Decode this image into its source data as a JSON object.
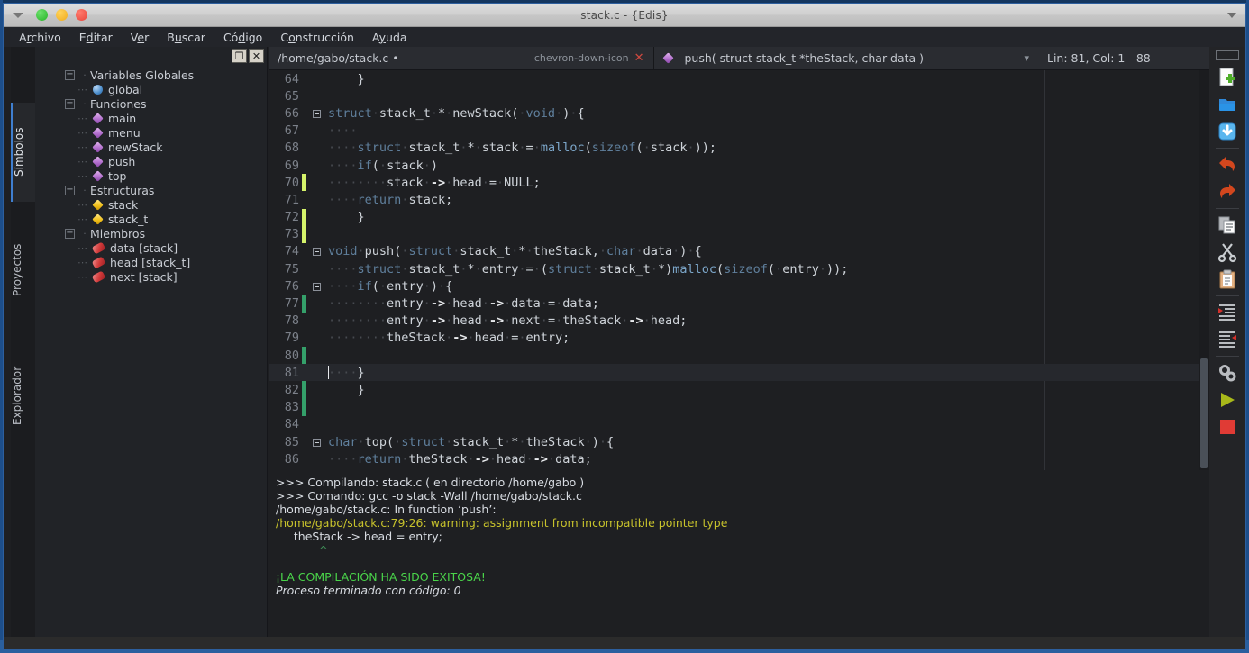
{
  "window": {
    "title": "stack.c - {Edis}",
    "controls": [
      "minimize",
      "maximize",
      "close"
    ],
    "menu_arrow_icon": "caret-down-icon"
  },
  "menubar": [
    {
      "pre": "A",
      "acc": "r",
      "post": "chivo",
      "label": "Archivo"
    },
    {
      "pre": "E",
      "acc": "d",
      "post": "itar",
      "label": "Editar"
    },
    {
      "pre": "V",
      "acc": "e",
      "post": "r",
      "label": "Ver"
    },
    {
      "pre": "B",
      "acc": "u",
      "post": "scar",
      "label": "Buscar"
    },
    {
      "pre": "Có",
      "acc": "d",
      "post": "igo",
      "label": "Código"
    },
    {
      "pre": "C",
      "acc": "o",
      "post": "nstrucción",
      "label": "Construcción"
    },
    {
      "pre": "A",
      "acc": "y",
      "post": "uda",
      "label": "Ayuda"
    }
  ],
  "vtabs": [
    {
      "label": "Símbolos",
      "active": true
    },
    {
      "label": "Proyectos",
      "active": false
    },
    {
      "label": "Explorador",
      "active": false
    }
  ],
  "panel_buttons": {
    "restore": "❐",
    "close": "✕"
  },
  "symbols_tree": [
    {
      "level": 0,
      "type": "group",
      "icon": "expander-minus",
      "label": "Variables Globales"
    },
    {
      "level": 1,
      "type": "leaf",
      "icon": "sphere-icon",
      "label": "global"
    },
    {
      "level": 0,
      "type": "group",
      "icon": "expander-minus",
      "label": "Funciones"
    },
    {
      "level": 1,
      "type": "leaf",
      "icon": "diamond-purple-icon",
      "label": "main"
    },
    {
      "level": 1,
      "type": "leaf",
      "icon": "diamond-purple-icon",
      "label": "menu"
    },
    {
      "level": 1,
      "type": "leaf",
      "icon": "diamond-purple-icon",
      "label": "newStack"
    },
    {
      "level": 1,
      "type": "leaf",
      "icon": "diamond-purple-icon",
      "label": "push"
    },
    {
      "level": 1,
      "type": "leaf",
      "icon": "diamond-purple-icon",
      "label": "top"
    },
    {
      "level": 0,
      "type": "group",
      "icon": "expander-minus",
      "label": "Estructuras"
    },
    {
      "level": 1,
      "type": "leaf",
      "icon": "diamond-gold-icon",
      "label": "stack"
    },
    {
      "level": 1,
      "type": "leaf",
      "icon": "diamond-gold-icon",
      "label": "stack_t"
    },
    {
      "level": 0,
      "type": "group",
      "icon": "expander-minus",
      "label": "Miembros"
    },
    {
      "level": 1,
      "type": "leaf",
      "icon": "capsule-red-icon",
      "label": "data [stack]"
    },
    {
      "level": 1,
      "type": "leaf",
      "icon": "capsule-red-icon",
      "label": "head [stack_t]"
    },
    {
      "level": 1,
      "type": "leaf",
      "icon": "capsule-red-icon",
      "label": "next [stack]"
    }
  ],
  "editor_tabbar": {
    "file_path": "/home/gabo/stack.c",
    "modified_dot": "•",
    "dropdown_icon": "chevron-down-icon",
    "close_icon": "close-icon",
    "symbol_icon": "diamond-purple-icon",
    "symbol": "push( struct stack_t *theStack, char data )",
    "symbol_dropdown_icon": "chevron-down-icon",
    "position": "Lin: 81, Col: 1 - 88"
  },
  "code_lines": [
    {
      "n": "64",
      "mark": "",
      "fold": "",
      "segs": [
        {
          "t": "    ",
          "c": "ws"
        },
        {
          "t": "}",
          "c": "pl"
        }
      ]
    },
    {
      "n": "65",
      "mark": "",
      "fold": "",
      "segs": []
    },
    {
      "n": "66",
      "mark": "",
      "fold": "minus",
      "segs": [
        {
          "t": "struct",
          "c": "kw"
        },
        {
          "t": "·",
          "c": "ws"
        },
        {
          "t": "stack_t",
          "c": "pl"
        },
        {
          "t": "·",
          "c": "ws"
        },
        {
          "t": "*",
          "c": "pl"
        },
        {
          "t": "·",
          "c": "ws"
        },
        {
          "t": "newStack(",
          "c": "pl"
        },
        {
          "t": "·",
          "c": "ws"
        },
        {
          "t": "void",
          "c": "kw"
        },
        {
          "t": "·",
          "c": "ws"
        },
        {
          "t": ")",
          "c": "pl"
        },
        {
          "t": "·",
          "c": "ws"
        },
        {
          "t": "{",
          "c": "pl"
        }
      ]
    },
    {
      "n": "67",
      "mark": "",
      "fold": "",
      "segs": [
        {
          "t": "····",
          "c": "ws"
        }
      ]
    },
    {
      "n": "68",
      "mark": "",
      "fold": "",
      "segs": [
        {
          "t": "····",
          "c": "ws"
        },
        {
          "t": "struct",
          "c": "kw"
        },
        {
          "t": "·",
          "c": "ws"
        },
        {
          "t": "stack_t",
          "c": "pl"
        },
        {
          "t": "·",
          "c": "ws"
        },
        {
          "t": "*",
          "c": "pl"
        },
        {
          "t": "·",
          "c": "ws"
        },
        {
          "t": "stack",
          "c": "pl"
        },
        {
          "t": "·",
          "c": "ws"
        },
        {
          "t": "=",
          "c": "pl"
        },
        {
          "t": "·",
          "c": "ws"
        },
        {
          "t": "malloc",
          "c": "fn"
        },
        {
          "t": "(",
          "c": "pl"
        },
        {
          "t": "sizeof",
          "c": "kw"
        },
        {
          "t": "(",
          "c": "pl"
        },
        {
          "t": "·",
          "c": "ws"
        },
        {
          "t": "stack",
          "c": "pl"
        },
        {
          "t": "·",
          "c": "ws"
        },
        {
          "t": "));",
          "c": "pl"
        }
      ]
    },
    {
      "n": "69",
      "mark": "",
      "fold": "",
      "segs": [
        {
          "t": "····",
          "c": "ws"
        },
        {
          "t": "if",
          "c": "kw"
        },
        {
          "t": "(",
          "c": "pl"
        },
        {
          "t": "·",
          "c": "ws"
        },
        {
          "t": "stack",
          "c": "pl"
        },
        {
          "t": "·",
          "c": "ws"
        },
        {
          "t": ")",
          "c": "pl"
        }
      ]
    },
    {
      "n": "70",
      "mark": "yl",
      "fold": "",
      "segs": [
        {
          "t": "········",
          "c": "ws"
        },
        {
          "t": "stack",
          "c": "pl"
        },
        {
          "t": "·",
          "c": "ws"
        },
        {
          "t": "->",
          "c": "op"
        },
        {
          "t": "·",
          "c": "ws"
        },
        {
          "t": "head",
          "c": "pl"
        },
        {
          "t": "·",
          "c": "ws"
        },
        {
          "t": "=",
          "c": "pl"
        },
        {
          "t": "·",
          "c": "ws"
        },
        {
          "t": "NULL;",
          "c": "pl"
        }
      ]
    },
    {
      "n": "71",
      "mark": "",
      "fold": "",
      "segs": [
        {
          "t": "····",
          "c": "ws"
        },
        {
          "t": "return",
          "c": "kw"
        },
        {
          "t": "·",
          "c": "ws"
        },
        {
          "t": "stack;",
          "c": "pl"
        }
      ]
    },
    {
      "n": "72",
      "mark": "yl",
      "fold": "",
      "segs": [
        {
          "t": "    ",
          "c": "ws"
        },
        {
          "t": "}",
          "c": "pl"
        }
      ]
    },
    {
      "n": "73",
      "mark": "yl",
      "fold": "",
      "segs": []
    },
    {
      "n": "74",
      "mark": "",
      "fold": "minus",
      "segs": [
        {
          "t": "void",
          "c": "kw"
        },
        {
          "t": "·",
          "c": "ws"
        },
        {
          "t": "push(",
          "c": "pl"
        },
        {
          "t": "·",
          "c": "ws"
        },
        {
          "t": "struct",
          "c": "kw"
        },
        {
          "t": "·",
          "c": "ws"
        },
        {
          "t": "stack_t",
          "c": "pl"
        },
        {
          "t": "·",
          "c": "ws"
        },
        {
          "t": "*",
          "c": "pl"
        },
        {
          "t": "·",
          "c": "ws"
        },
        {
          "t": "theStack,",
          "c": "pl"
        },
        {
          "t": "·",
          "c": "ws"
        },
        {
          "t": "char",
          "c": "kw"
        },
        {
          "t": "·",
          "c": "ws"
        },
        {
          "t": "data",
          "c": "pl"
        },
        {
          "t": "·",
          "c": "ws"
        },
        {
          "t": ")",
          "c": "pl"
        },
        {
          "t": "·",
          "c": "ws"
        },
        {
          "t": "{",
          "c": "pl"
        }
      ]
    },
    {
      "n": "75",
      "mark": "",
      "fold": "",
      "segs": [
        {
          "t": "····",
          "c": "ws"
        },
        {
          "t": "struct",
          "c": "kw"
        },
        {
          "t": "·",
          "c": "ws"
        },
        {
          "t": "stack_t",
          "c": "pl"
        },
        {
          "t": "·",
          "c": "ws"
        },
        {
          "t": "*",
          "c": "pl"
        },
        {
          "t": "·",
          "c": "ws"
        },
        {
          "t": "entry",
          "c": "pl"
        },
        {
          "t": "·",
          "c": "ws"
        },
        {
          "t": "=",
          "c": "pl"
        },
        {
          "t": "·",
          "c": "ws"
        },
        {
          "t": "(",
          "c": "pl"
        },
        {
          "t": "struct",
          "c": "kw"
        },
        {
          "t": "·",
          "c": "ws"
        },
        {
          "t": "stack_t",
          "c": "pl"
        },
        {
          "t": "·",
          "c": "ws"
        },
        {
          "t": "*)",
          "c": "pl"
        },
        {
          "t": "malloc",
          "c": "fn"
        },
        {
          "t": "(",
          "c": "pl"
        },
        {
          "t": "sizeof",
          "c": "kw"
        },
        {
          "t": "(",
          "c": "pl"
        },
        {
          "t": "·",
          "c": "ws"
        },
        {
          "t": "entry",
          "c": "pl"
        },
        {
          "t": "·",
          "c": "ws"
        },
        {
          "t": "));",
          "c": "pl"
        }
      ]
    },
    {
      "n": "76",
      "mark": "",
      "fold": "minus",
      "segs": [
        {
          "t": "····",
          "c": "ws"
        },
        {
          "t": "if",
          "c": "kw"
        },
        {
          "t": "(",
          "c": "pl"
        },
        {
          "t": "·",
          "c": "ws"
        },
        {
          "t": "entry",
          "c": "pl"
        },
        {
          "t": "·",
          "c": "ws"
        },
        {
          "t": ")",
          "c": "pl"
        },
        {
          "t": "·",
          "c": "ws"
        },
        {
          "t": "{",
          "c": "pl"
        }
      ]
    },
    {
      "n": "77",
      "mark": "gr",
      "fold": "",
      "segs": [
        {
          "t": "········",
          "c": "ws"
        },
        {
          "t": "entry",
          "c": "pl"
        },
        {
          "t": "·",
          "c": "ws"
        },
        {
          "t": "->",
          "c": "op"
        },
        {
          "t": "·",
          "c": "ws"
        },
        {
          "t": "head",
          "c": "pl"
        },
        {
          "t": "·",
          "c": "ws"
        },
        {
          "t": "->",
          "c": "op"
        },
        {
          "t": "·",
          "c": "ws"
        },
        {
          "t": "data",
          "c": "pl"
        },
        {
          "t": "·",
          "c": "ws"
        },
        {
          "t": "=",
          "c": "pl"
        },
        {
          "t": "·",
          "c": "ws"
        },
        {
          "t": "data;",
          "c": "pl"
        }
      ]
    },
    {
      "n": "78",
      "mark": "",
      "fold": "",
      "segs": [
        {
          "t": "········",
          "c": "ws"
        },
        {
          "t": "entry",
          "c": "pl"
        },
        {
          "t": "·",
          "c": "ws"
        },
        {
          "t": "->",
          "c": "op"
        },
        {
          "t": "·",
          "c": "ws"
        },
        {
          "t": "head",
          "c": "pl"
        },
        {
          "t": "·",
          "c": "ws"
        },
        {
          "t": "->",
          "c": "op"
        },
        {
          "t": "·",
          "c": "ws"
        },
        {
          "t": "next",
          "c": "pl"
        },
        {
          "t": "·",
          "c": "ws"
        },
        {
          "t": "=",
          "c": "pl"
        },
        {
          "t": "·",
          "c": "ws"
        },
        {
          "t": "theStack",
          "c": "pl"
        },
        {
          "t": "·",
          "c": "ws"
        },
        {
          "t": "->",
          "c": "op"
        },
        {
          "t": "·",
          "c": "ws"
        },
        {
          "t": "head;",
          "c": "pl"
        }
      ]
    },
    {
      "n": "79",
      "mark": "",
      "fold": "",
      "segs": [
        {
          "t": "········",
          "c": "ws"
        },
        {
          "t": "theStack",
          "c": "pl"
        },
        {
          "t": "·",
          "c": "ws"
        },
        {
          "t": "->",
          "c": "op"
        },
        {
          "t": "·",
          "c": "ws"
        },
        {
          "t": "head",
          "c": "pl"
        },
        {
          "t": "·",
          "c": "ws"
        },
        {
          "t": "=",
          "c": "pl"
        },
        {
          "t": "·",
          "c": "ws"
        },
        {
          "t": "entry;",
          "c": "pl"
        }
      ]
    },
    {
      "n": "80",
      "mark": "gr",
      "fold": "",
      "segs": []
    },
    {
      "n": "81",
      "mark": "",
      "fold": "",
      "current": true,
      "caret": true,
      "segs": [
        {
          "t": "····",
          "c": "ws"
        },
        {
          "t": "}",
          "c": "pl"
        }
      ]
    },
    {
      "n": "82",
      "mark": "gr",
      "fold": "",
      "segs": [
        {
          "t": "    ",
          "c": "ws"
        },
        {
          "t": "}",
          "c": "pl"
        }
      ]
    },
    {
      "n": "83",
      "mark": "gr",
      "fold": "",
      "segs": []
    },
    {
      "n": "84",
      "mark": "",
      "fold": "",
      "segs": []
    },
    {
      "n": "85",
      "mark": "",
      "fold": "minus",
      "segs": [
        {
          "t": "char",
          "c": "kw"
        },
        {
          "t": "·",
          "c": "ws"
        },
        {
          "t": "top(",
          "c": "pl"
        },
        {
          "t": "·",
          "c": "ws"
        },
        {
          "t": "struct",
          "c": "kw"
        },
        {
          "t": "·",
          "c": "ws"
        },
        {
          "t": "stack_t",
          "c": "pl"
        },
        {
          "t": "·",
          "c": "ws"
        },
        {
          "t": "*",
          "c": "pl"
        },
        {
          "t": "·",
          "c": "ws"
        },
        {
          "t": "theStack",
          "c": "pl"
        },
        {
          "t": "·",
          "c": "ws"
        },
        {
          "t": ")",
          "c": "pl"
        },
        {
          "t": "·",
          "c": "ws"
        },
        {
          "t": "{",
          "c": "pl"
        }
      ]
    },
    {
      "n": "86",
      "mark": "",
      "fold": "",
      "segs": [
        {
          "t": "····",
          "c": "ws"
        },
        {
          "t": "return",
          "c": "kw"
        },
        {
          "t": "·",
          "c": "ws"
        },
        {
          "t": "theStack",
          "c": "pl"
        },
        {
          "t": "·",
          "c": "ws"
        },
        {
          "t": "->",
          "c": "op"
        },
        {
          "t": "·",
          "c": "ws"
        },
        {
          "t": "head",
          "c": "pl"
        },
        {
          "t": "·",
          "c": "ws"
        },
        {
          "t": "->",
          "c": "op"
        },
        {
          "t": "·",
          "c": "ws"
        },
        {
          "t": "data;",
          "c": "pl"
        }
      ]
    }
  ],
  "output": [
    {
      "text": ">>> Compilando: stack.c ( en directorio /home/gabo )",
      "style": "o-white"
    },
    {
      "text": ">>> Comando: gcc -o stack -Wall /home/gabo/stack.c",
      "style": "o-white"
    },
    {
      "text": "/home/gabo/stack.c: In function ‘push’:",
      "style": "o-white"
    },
    {
      "text": "/home/gabo/stack.c:79:26: warning: assignment from incompatible pointer type",
      "style": "o-warn"
    },
    {
      "text": "     theStack -> head = entry;",
      "style": "o-white"
    },
    {
      "text": "            ^",
      "style": "o-caret"
    },
    {
      "text": "",
      "style": "o-white"
    },
    {
      "text": "¡LA COMPILACIÓN HA SIDO EXITOSA!",
      "style": "o-ok"
    },
    {
      "text": "Proceso terminado con código: 0",
      "style": "o-ital"
    }
  ],
  "toolbar": [
    {
      "name": "new-file-icon",
      "sep_after": false
    },
    {
      "name": "open-folder-icon",
      "sep_after": false
    },
    {
      "name": "save-icon",
      "sep_after": true
    },
    {
      "name": "undo-icon",
      "sep_after": false
    },
    {
      "name": "redo-icon",
      "sep_after": true
    },
    {
      "name": "copy-icon",
      "sep_after": false
    },
    {
      "name": "cut-icon",
      "sep_after": false
    },
    {
      "name": "paste-icon",
      "sep_after": true
    },
    {
      "name": "indent-icon",
      "sep_after": false
    },
    {
      "name": "unindent-icon",
      "sep_after": true
    },
    {
      "name": "build-gears-icon",
      "sep_after": false
    },
    {
      "name": "run-icon",
      "sep_after": false
    },
    {
      "name": "stop-icon",
      "sep_after": false
    }
  ],
  "colors": {
    "accent_blue": "#2d5f9e",
    "editor_bg": "#1e1f22",
    "panel_bg": "#212327",
    "success_green": "#4ad44a",
    "warning_yellow": "#c7c22c",
    "marker_unsaved": "#d5f36a",
    "marker_saved": "#34a06a"
  }
}
